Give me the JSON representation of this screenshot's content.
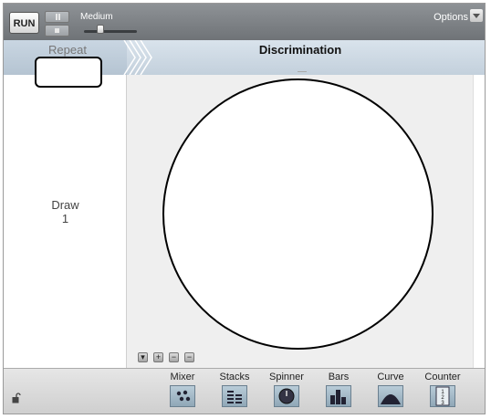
{
  "toolbar": {
    "run_label": "RUN",
    "speed_label": "Medium",
    "options_label": "Options"
  },
  "header": {
    "repeat_label": "Repeat",
    "title": "Discrimination"
  },
  "left_panel": {
    "draw_label": "Draw",
    "draw_count": "1"
  },
  "zoom_controls": [
    "▾",
    "+",
    "−",
    "−"
  ],
  "bottom_tools": [
    {
      "label": "Mixer",
      "icon": "mixer-icon"
    },
    {
      "label": "Stacks",
      "icon": "stacks-icon"
    },
    {
      "label": "Spinner",
      "icon": "spinner-icon"
    },
    {
      "label": "Bars",
      "icon": "bars-icon"
    },
    {
      "label": "Curve",
      "icon": "curve-icon"
    },
    {
      "label": "Counter",
      "icon": "counter-icon"
    }
  ]
}
